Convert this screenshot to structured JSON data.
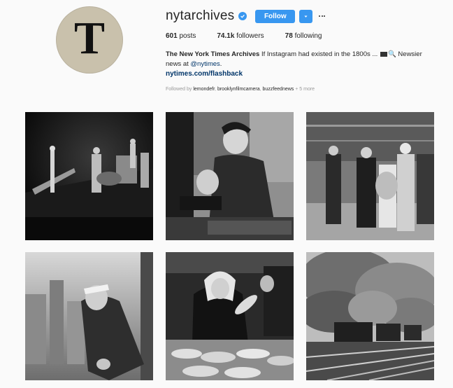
{
  "profile": {
    "avatar_glyph": "T",
    "username": "nytarchives",
    "follow_label": "Follow",
    "stats": {
      "posts_count": "601",
      "posts_label": "posts",
      "followers_count": "74.1k",
      "followers_label": "followers",
      "following_count": "78",
      "following_label": "following"
    },
    "bio": {
      "name": "The New York Times Archives",
      "text": "If Instagram had existed in the 1800s ...",
      "text2": "Newsier news at",
      "mention": "@nytimes",
      "text3": ".",
      "link": "nytimes.com/flashback"
    },
    "followed_by": {
      "prefix": "Followed by",
      "accounts": [
        "lemondefr",
        "brooklynfilmcamera",
        "buzzfeednews"
      ],
      "more": "+ 5 more"
    }
  },
  "icons": {
    "verified": "verified-badge-icon",
    "dropdown": "chevron-down-icon",
    "more": "more-options-icon"
  },
  "colors": {
    "accent": "#3897f0",
    "link": "#003569",
    "muted": "#999999",
    "background": "#fafafa"
  },
  "posts": [
    {
      "subject": "jazz band performing on a dark stage"
    },
    {
      "subject": "young man polishing shoes at a bootblack stand"
    },
    {
      "subject": "woman in dress with men on a baseball field"
    },
    {
      "subject": "sailor on skyscraper ledge above city"
    },
    {
      "subject": "woman in headscarf at fish market"
    },
    {
      "subject": "steam locomotives with smoke on railway tracks"
    }
  ]
}
